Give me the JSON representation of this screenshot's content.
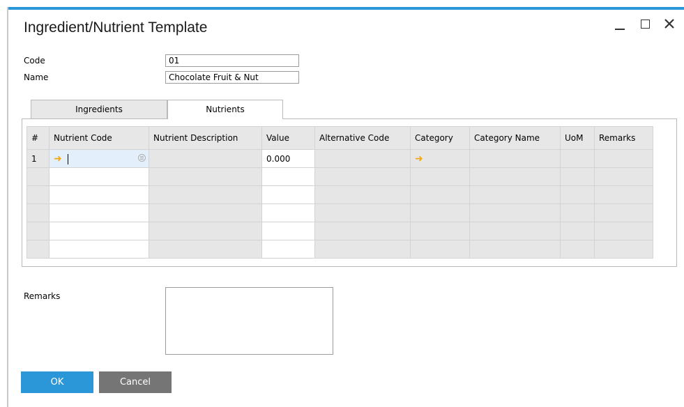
{
  "window": {
    "title": "Ingredient/Nutrient Template"
  },
  "header": {
    "code_label": "Code",
    "code_value": "01",
    "name_label": "Name",
    "name_value": "Chocolate Fruit & Nut"
  },
  "tabs": [
    {
      "label": "Ingredients",
      "active": false
    },
    {
      "label": "Nutrients",
      "active": true
    }
  ],
  "grid": {
    "columns": [
      "#",
      "Nutrient Code",
      "Nutrient Description",
      "Value",
      "Alternative Code",
      "Category",
      "Category Name",
      "UoM",
      "Remarks"
    ],
    "rows": [
      {
        "num": "1",
        "nutrient_code": "",
        "nutrient_description": "",
        "value": "0.000",
        "alternative_code": "",
        "category": "",
        "category_name": "",
        "uom": "",
        "remarks": ""
      }
    ],
    "empty_rows": 5
  },
  "remarks": {
    "label": "Remarks",
    "value": ""
  },
  "buttons": {
    "ok": "OK",
    "cancel": "Cancel"
  },
  "colors": {
    "accent": "#2b97d8",
    "link_arrow": "#f0a818",
    "cancel_button": "#757575",
    "grid_readonly": "#e6e6e6"
  }
}
